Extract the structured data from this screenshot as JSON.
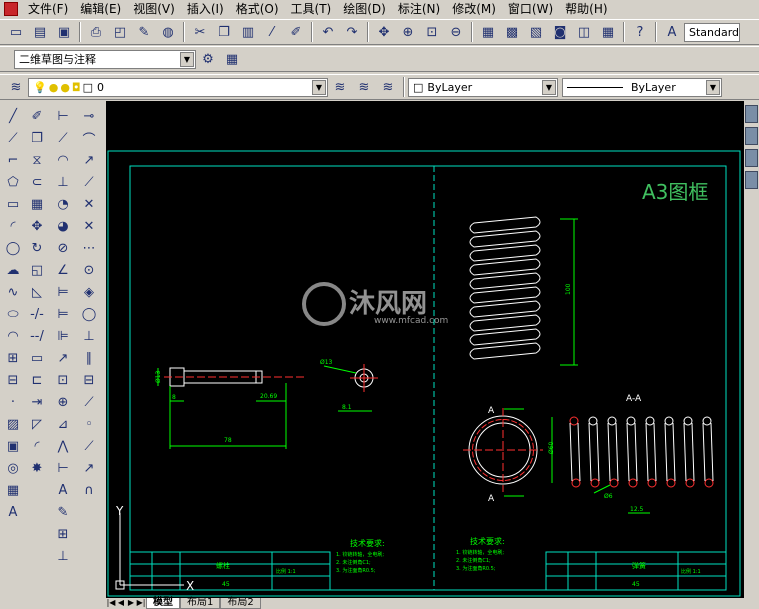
{
  "menu": [
    "文件(F)",
    "编辑(E)",
    "视图(V)",
    "插入(I)",
    "格式(O)",
    "工具(T)",
    "绘图(D)",
    "标注(N)",
    "修改(M)",
    "窗口(W)",
    "帮助(H)"
  ],
  "toolbar": {
    "text_style": "Standard"
  },
  "workspace": {
    "value": "二维草图与注释"
  },
  "layers": {
    "current": "0",
    "color": "ByLayer",
    "linetype": "ByLayer"
  },
  "drawing": {
    "frame_title": "A3图框",
    "watermark_main": "沐风网",
    "watermark_url": "www.mfcad.com",
    "left_tech_title": "技术要求:",
    "left_tech_items": [
      "1. 铰链转轴，全电刷;",
      "2. 未注倒角C1;",
      "3. 为注面角R0.5;"
    ],
    "right_tech_title": "技术要求:",
    "right_tech_items": [
      "1. 铰链转轴，全电刷;",
      "2. 未注倒角C1;",
      "3. 为注面角R0.5;"
    ],
    "section_label": "A-A",
    "label_A": "A",
    "dims": {
      "d13": "Ø13",
      "d13b": "Ø13",
      "d8_1": "8.1",
      "d8": "8",
      "d20": "20.69",
      "d78": "78",
      "d100": "100",
      "d60": "Ø60",
      "d6": "Ø6",
      "d12": "12.5"
    },
    "left_block": {
      "name": "螺栓",
      "material": "45",
      "scale": "比例 1:1"
    },
    "right_block": {
      "name": "弹簧",
      "material": "45",
      "scale": "比例 1:1"
    },
    "axis_y": "Y",
    "axis_x": "X"
  },
  "tabs": [
    "模型",
    "布局1",
    "布局2"
  ],
  "colors": {
    "canvas": "#000000",
    "frame": "#00e0c0",
    "geometry": "#ffffff",
    "dim": "#00ff00",
    "center": "#ff3030",
    "title": "#40c060"
  }
}
